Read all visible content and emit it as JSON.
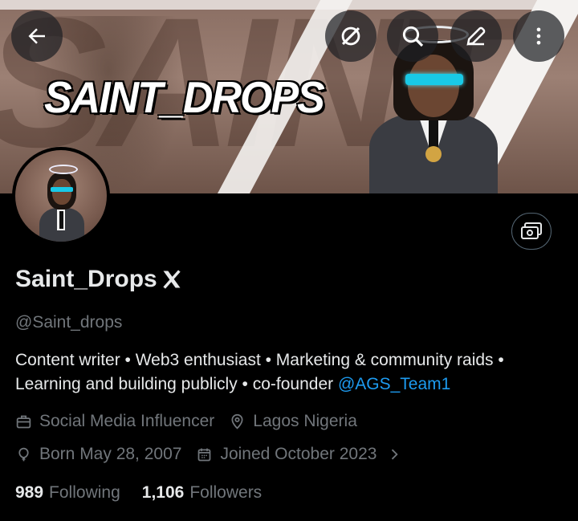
{
  "banner": {
    "title": "SAINT_DROPS"
  },
  "profile": {
    "display_name": "Saint_Drops",
    "handle": "@Saint_drops",
    "bio_text": "Content writer • Web3 enthusiast • Marketing & community raids • Learning and building publicly • co-founder ",
    "bio_mention": "@AGS_Team1",
    "category": "Social Media Influencer",
    "location": "Lagos Nigeria",
    "birthday": "Born May 28, 2007",
    "joined": "Joined October 2023",
    "following_count": "989",
    "following_label": "Following",
    "followers_count": "1,106",
    "followers_label": "Followers"
  },
  "icons": {
    "back": "arrow-left-icon",
    "grok": "grok-slash-icon",
    "search": "search-icon",
    "edit": "pencil-icon",
    "more": "more-vertical-icon",
    "card": "card-icon",
    "verified": "x-badge-icon",
    "category": "briefcase-icon",
    "location": "location-pin-icon",
    "birthday": "balloon-icon",
    "calendar": "calendar-icon",
    "chevron": "chevron-right-icon"
  },
  "colors": {
    "background": "#000000",
    "text": "#e7e9ea",
    "muted": "#71767b",
    "link": "#1d9bf0"
  }
}
